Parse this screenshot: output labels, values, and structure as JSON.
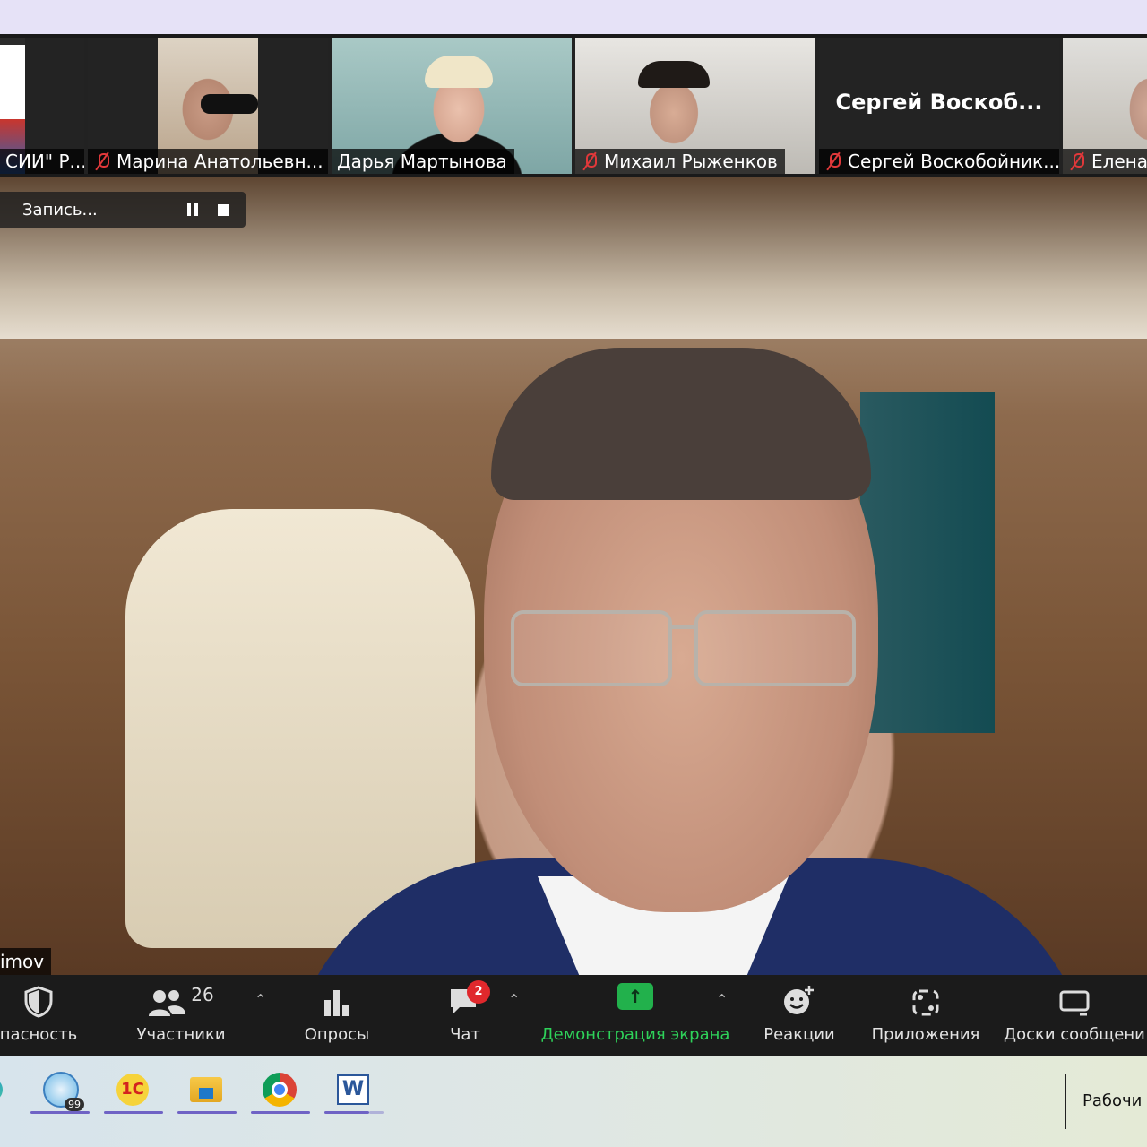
{
  "gallery": {
    "tiles": [
      {
        "name": "СИИ\" Р...",
        "muted": false
      },
      {
        "name": "Марина Анатольевн...",
        "muted": true
      },
      {
        "name": "Дарья Мартынова",
        "muted": false
      },
      {
        "name": "Михаил Рыженков",
        "muted": true
      },
      {
        "name": "Сергей Воскобойник...",
        "muted": true,
        "center_name": "Сергей  Воскоб..."
      },
      {
        "name": "Елена",
        "muted": true
      }
    ]
  },
  "recording": {
    "label": "Запись..."
  },
  "speaker": {
    "name": "imov"
  },
  "toolbar": {
    "security": "пасность",
    "participants": "Участники",
    "participants_count": "26",
    "polls": "Опросы",
    "chat": "Чат",
    "chat_badge": "2",
    "share_screen": "Демонстрация экрана",
    "reactions": "Реакции",
    "apps": "Приложения",
    "whiteboards": "Доски сообщени"
  },
  "taskbar": {
    "tray_text": "Рабочи",
    "apps": [
      "edge-icon",
      "clock-widget-icon",
      "1c-icon",
      "file-explorer-icon",
      "chrome-icon",
      "word-icon"
    ],
    "clock_badge": "99"
  },
  "colors": {
    "accent_green": "#2ed35a",
    "muted_red": "#e0383a",
    "badge_red": "#e0282c",
    "taskbar_underline": "#6f63c5"
  }
}
